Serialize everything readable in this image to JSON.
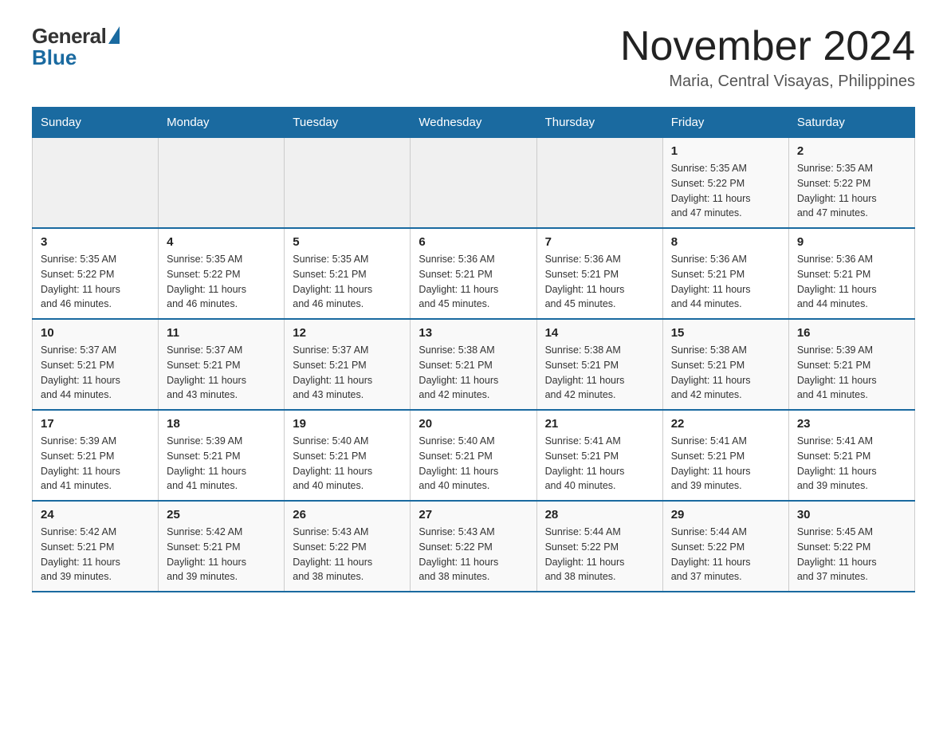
{
  "logo": {
    "general": "General",
    "blue": "Blue"
  },
  "title": "November 2024",
  "location": "Maria, Central Visayas, Philippines",
  "days_header": [
    "Sunday",
    "Monday",
    "Tuesday",
    "Wednesday",
    "Thursday",
    "Friday",
    "Saturday"
  ],
  "weeks": [
    [
      {
        "num": "",
        "info": ""
      },
      {
        "num": "",
        "info": ""
      },
      {
        "num": "",
        "info": ""
      },
      {
        "num": "",
        "info": ""
      },
      {
        "num": "",
        "info": ""
      },
      {
        "num": "1",
        "info": "Sunrise: 5:35 AM\nSunset: 5:22 PM\nDaylight: 11 hours\nand 47 minutes."
      },
      {
        "num": "2",
        "info": "Sunrise: 5:35 AM\nSunset: 5:22 PM\nDaylight: 11 hours\nand 47 minutes."
      }
    ],
    [
      {
        "num": "3",
        "info": "Sunrise: 5:35 AM\nSunset: 5:22 PM\nDaylight: 11 hours\nand 46 minutes."
      },
      {
        "num": "4",
        "info": "Sunrise: 5:35 AM\nSunset: 5:22 PM\nDaylight: 11 hours\nand 46 minutes."
      },
      {
        "num": "5",
        "info": "Sunrise: 5:35 AM\nSunset: 5:21 PM\nDaylight: 11 hours\nand 46 minutes."
      },
      {
        "num": "6",
        "info": "Sunrise: 5:36 AM\nSunset: 5:21 PM\nDaylight: 11 hours\nand 45 minutes."
      },
      {
        "num": "7",
        "info": "Sunrise: 5:36 AM\nSunset: 5:21 PM\nDaylight: 11 hours\nand 45 minutes."
      },
      {
        "num": "8",
        "info": "Sunrise: 5:36 AM\nSunset: 5:21 PM\nDaylight: 11 hours\nand 44 minutes."
      },
      {
        "num": "9",
        "info": "Sunrise: 5:36 AM\nSunset: 5:21 PM\nDaylight: 11 hours\nand 44 minutes."
      }
    ],
    [
      {
        "num": "10",
        "info": "Sunrise: 5:37 AM\nSunset: 5:21 PM\nDaylight: 11 hours\nand 44 minutes."
      },
      {
        "num": "11",
        "info": "Sunrise: 5:37 AM\nSunset: 5:21 PM\nDaylight: 11 hours\nand 43 minutes."
      },
      {
        "num": "12",
        "info": "Sunrise: 5:37 AM\nSunset: 5:21 PM\nDaylight: 11 hours\nand 43 minutes."
      },
      {
        "num": "13",
        "info": "Sunrise: 5:38 AM\nSunset: 5:21 PM\nDaylight: 11 hours\nand 42 minutes."
      },
      {
        "num": "14",
        "info": "Sunrise: 5:38 AM\nSunset: 5:21 PM\nDaylight: 11 hours\nand 42 minutes."
      },
      {
        "num": "15",
        "info": "Sunrise: 5:38 AM\nSunset: 5:21 PM\nDaylight: 11 hours\nand 42 minutes."
      },
      {
        "num": "16",
        "info": "Sunrise: 5:39 AM\nSunset: 5:21 PM\nDaylight: 11 hours\nand 41 minutes."
      }
    ],
    [
      {
        "num": "17",
        "info": "Sunrise: 5:39 AM\nSunset: 5:21 PM\nDaylight: 11 hours\nand 41 minutes."
      },
      {
        "num": "18",
        "info": "Sunrise: 5:39 AM\nSunset: 5:21 PM\nDaylight: 11 hours\nand 41 minutes."
      },
      {
        "num": "19",
        "info": "Sunrise: 5:40 AM\nSunset: 5:21 PM\nDaylight: 11 hours\nand 40 minutes."
      },
      {
        "num": "20",
        "info": "Sunrise: 5:40 AM\nSunset: 5:21 PM\nDaylight: 11 hours\nand 40 minutes."
      },
      {
        "num": "21",
        "info": "Sunrise: 5:41 AM\nSunset: 5:21 PM\nDaylight: 11 hours\nand 40 minutes."
      },
      {
        "num": "22",
        "info": "Sunrise: 5:41 AM\nSunset: 5:21 PM\nDaylight: 11 hours\nand 39 minutes."
      },
      {
        "num": "23",
        "info": "Sunrise: 5:41 AM\nSunset: 5:21 PM\nDaylight: 11 hours\nand 39 minutes."
      }
    ],
    [
      {
        "num": "24",
        "info": "Sunrise: 5:42 AM\nSunset: 5:21 PM\nDaylight: 11 hours\nand 39 minutes."
      },
      {
        "num": "25",
        "info": "Sunrise: 5:42 AM\nSunset: 5:21 PM\nDaylight: 11 hours\nand 39 minutes."
      },
      {
        "num": "26",
        "info": "Sunrise: 5:43 AM\nSunset: 5:22 PM\nDaylight: 11 hours\nand 38 minutes."
      },
      {
        "num": "27",
        "info": "Sunrise: 5:43 AM\nSunset: 5:22 PM\nDaylight: 11 hours\nand 38 minutes."
      },
      {
        "num": "28",
        "info": "Sunrise: 5:44 AM\nSunset: 5:22 PM\nDaylight: 11 hours\nand 38 minutes."
      },
      {
        "num": "29",
        "info": "Sunrise: 5:44 AM\nSunset: 5:22 PM\nDaylight: 11 hours\nand 37 minutes."
      },
      {
        "num": "30",
        "info": "Sunrise: 5:45 AM\nSunset: 5:22 PM\nDaylight: 11 hours\nand 37 minutes."
      }
    ]
  ]
}
